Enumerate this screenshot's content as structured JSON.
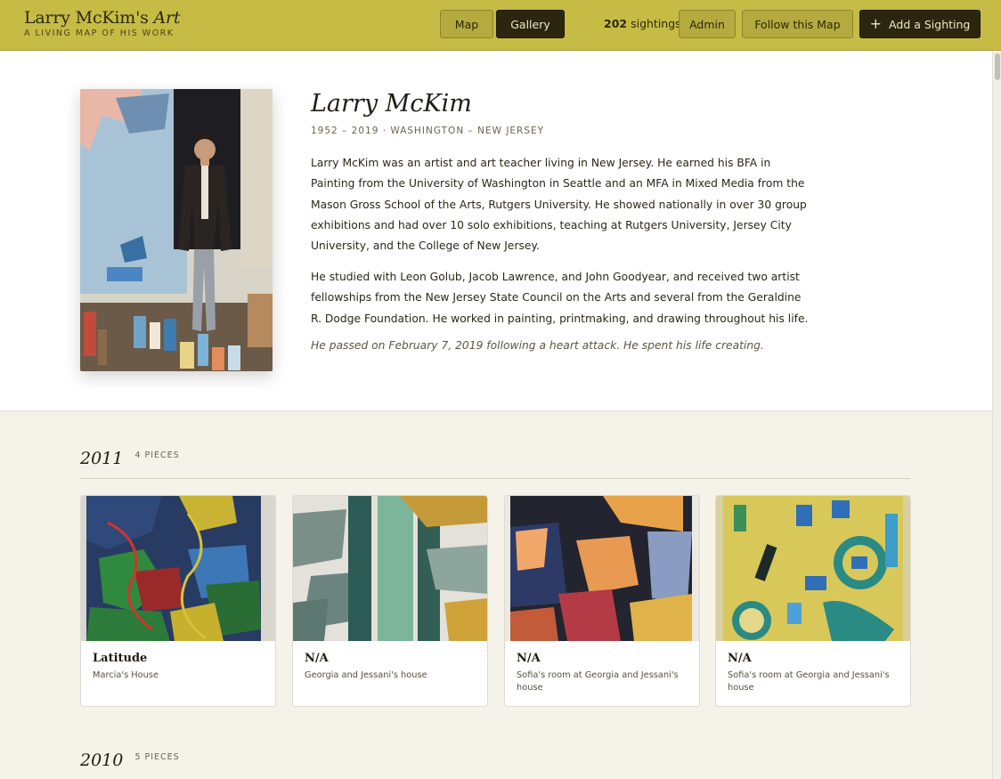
{
  "header": {
    "brand_name": "Larry McKim's",
    "brand_art": "Art",
    "tagline": "A LIVING MAP OF HIS WORK",
    "nav_map": "Map",
    "nav_gallery": "Gallery",
    "sightings_count": "202",
    "sightings_label": "sightings",
    "admin": "Admin",
    "follow": "Follow this Map",
    "add_sighting": "Add a Sighting",
    "add_icon": "plus-icon",
    "colors": {
      "bar": "#c6bb44",
      "dark_button": "#2a2610"
    }
  },
  "bio": {
    "name": "Larry McKim",
    "meta": "1952 – 2019 · WASHINGTON – NEW JERSEY",
    "paragraph1": "Larry McKim was an artist and art teacher living in New Jersey. He earned his BFA in Painting from the University of Washington in Seattle and an MFA in Mixed Media from the Mason Gross School of the Arts, Rutgers University. He showed nationally in over 30 group exhibitions and had over 10 solo exhibitions, teaching at Rutgers University, Jersey City University, and the College of New Jersey.",
    "paragraph2": "He studied with Leon Golub, Jacob Lawrence, and John Goodyear, and received two artist fellowships from the New Jersey State Council on the Arts and several from the Geraldine R. Dodge Foundation. He worked in painting, printmaking, and drawing throughout his life.",
    "note": "He passed on February 7, 2019 following a heart attack. He spent his life creating."
  },
  "gallery": {
    "years": [
      {
        "year": "2011",
        "count": "4 PIECES",
        "pieces": [
          {
            "title": "Latitude",
            "location": "Marcia's House"
          },
          {
            "title": "N/A",
            "location": "Georgia and Jessani's house"
          },
          {
            "title": "N/A",
            "location": "Sofia's room at Georgia and Jessani's house"
          },
          {
            "title": "N/A",
            "location": "Sofia's room at Georgia and Jessani's house"
          }
        ]
      },
      {
        "year": "2010",
        "count": "5 PIECES"
      }
    ]
  }
}
